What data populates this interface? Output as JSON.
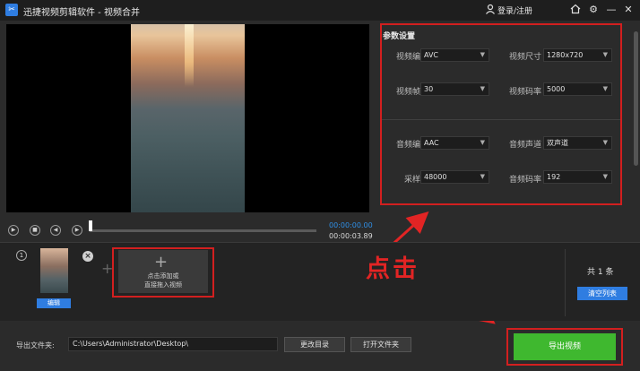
{
  "window": {
    "title": "迅捷视频剪辑软件 - 视频合并",
    "login_label": "登录/注册",
    "icons": [
      "app-logo-icon",
      "user-icon",
      "home-icon",
      "settings-icon",
      "minimize-icon",
      "close-icon"
    ]
  },
  "params": {
    "title": "参数设置",
    "video_codec": {
      "label": "视频编码",
      "value": "AVC"
    },
    "video_size": {
      "label": "视频尺寸",
      "value": "1280x720"
    },
    "video_fps": {
      "label": "视频帧率",
      "value": "30"
    },
    "video_bitrate": {
      "label": "视频码率",
      "value": "5000"
    },
    "audio_codec": {
      "label": "音频编码",
      "value": "AAC"
    },
    "audio_channel": {
      "label": "音频声道",
      "value": "双声道"
    },
    "sample_rate": {
      "label": "采样率",
      "value": "48000"
    },
    "audio_bitrate": {
      "label": "音频码率",
      "value": "192"
    }
  },
  "playback": {
    "current_time": "00:00:00.00",
    "total_time": "00:00:03.89",
    "progress": 0.0
  },
  "clips": {
    "index": "1",
    "edit_label": "编辑",
    "add_line1": "点击添加或",
    "add_line2": "直接拖入视频",
    "count_label": "共 1 条",
    "clear_label": "清空列表"
  },
  "annotation": "点击",
  "export": {
    "folder_label": "导出文件夹:",
    "path": "C:\\Users\\Administrator\\Desktop\\",
    "change_dir_label": "更改目录",
    "open_folder_label": "打开文件夹",
    "export_label": "导出视频"
  },
  "colors": {
    "accent_blue": "#2f7de1",
    "export_green": "#3fb82f",
    "annotation_red": "#e22424"
  }
}
